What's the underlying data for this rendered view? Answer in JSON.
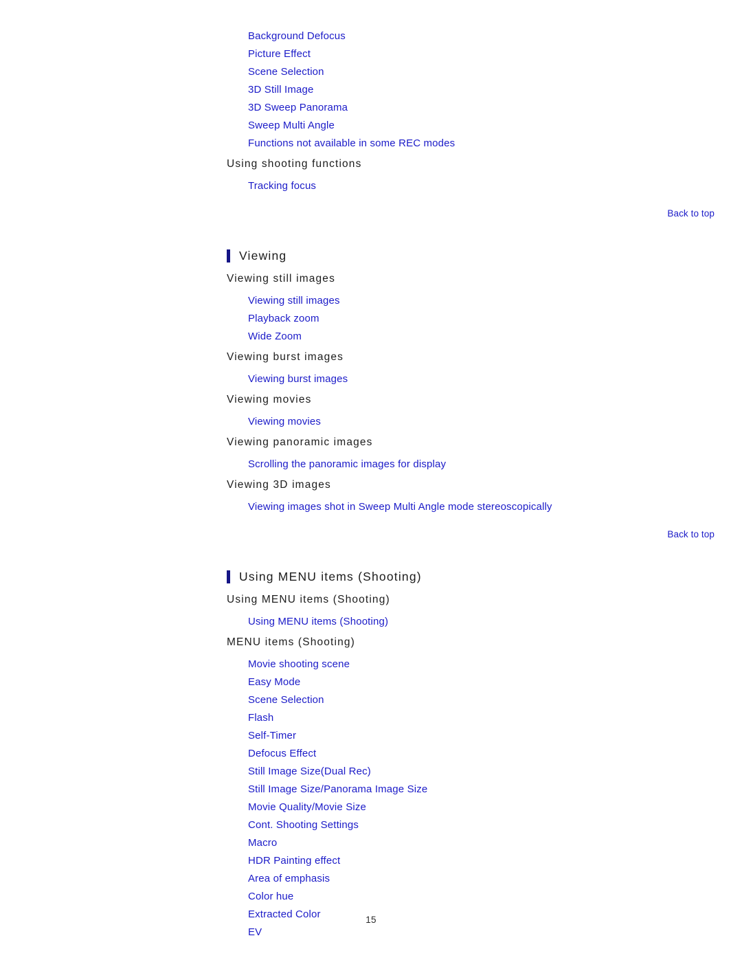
{
  "page": {
    "number": "15",
    "link_color": "#1b1bc8",
    "heading_color": "#1c1c1c",
    "bar_color": "#151586",
    "background": "#ffffff"
  },
  "back_to_top_label": "Back to top",
  "top_group": {
    "links_before_heading": [
      "Background Defocus",
      "Picture Effect",
      "Scene Selection",
      "3D Still Image",
      "3D Sweep Panorama",
      "Sweep Multi Angle",
      "Functions not available in some REC modes"
    ],
    "subheading": "Using shooting functions",
    "links": [
      "Tracking focus"
    ]
  },
  "sections": [
    {
      "title": "Viewing",
      "groups": [
        {
          "subheading": "Viewing still images",
          "links": [
            "Viewing still images",
            "Playback zoom",
            "Wide Zoom"
          ]
        },
        {
          "subheading": "Viewing burst images",
          "links": [
            "Viewing burst images"
          ]
        },
        {
          "subheading": "Viewing movies",
          "links": [
            "Viewing movies"
          ]
        },
        {
          "subheading": "Viewing panoramic images",
          "links": [
            "Scrolling the panoramic images for display"
          ]
        },
        {
          "subheading": "Viewing 3D images",
          "links": [
            "Viewing images shot in Sweep Multi Angle mode stereoscopically"
          ]
        }
      ]
    },
    {
      "title": "Using MENU items (Shooting)",
      "groups": [
        {
          "subheading": "Using MENU items (Shooting)",
          "links": [
            "Using MENU items (Shooting)"
          ]
        },
        {
          "subheading": "MENU items (Shooting)",
          "links": [
            "Movie shooting scene",
            "Easy Mode",
            "Scene Selection",
            "Flash",
            "Self-Timer",
            "Defocus Effect",
            "Still Image Size(Dual Rec)",
            "Still Image Size/Panorama Image Size",
            "Movie Quality/Movie Size",
            "Cont. Shooting Settings",
            "Macro",
            "HDR Painting effect",
            "Area of emphasis",
            "Color hue",
            "Extracted Color",
            "EV"
          ]
        }
      ]
    }
  ]
}
